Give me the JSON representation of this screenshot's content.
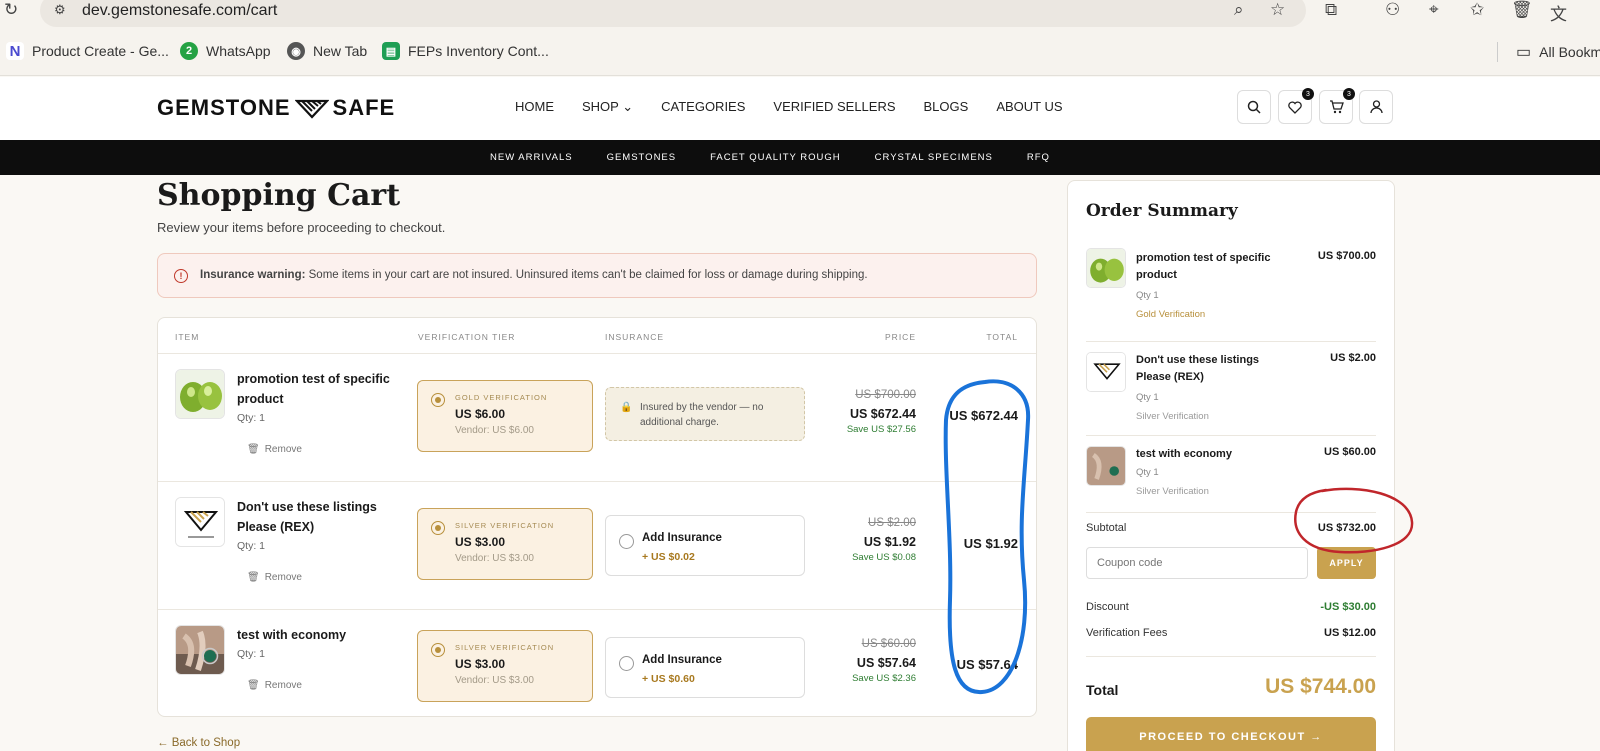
{
  "browser": {
    "url": "dev.gemstonesafe.com/cart",
    "bookmarks": [
      {
        "label": "Product Create - Ge...",
        "icon": "notion-icon"
      },
      {
        "label": "WhatsApp",
        "icon": "whatsapp-icon",
        "badge": "2"
      },
      {
        "label": "New Tab",
        "icon": "chrome-icon"
      },
      {
        "label": "FEPs Inventory Cont...",
        "icon": "sheets-icon"
      }
    ],
    "all_bookmarks": "All Bookm"
  },
  "header": {
    "logo_left": "GEMSTONE",
    "logo_right": "SAFE",
    "nav": [
      {
        "label": "HOME"
      },
      {
        "label": "SHOP ⌄"
      },
      {
        "label": "CATEGORIES"
      },
      {
        "label": "VERIFIED SELLERS"
      },
      {
        "label": "BLOGS"
      },
      {
        "label": "ABOUT US"
      }
    ],
    "wishlist_count": "3",
    "cart_count": "3",
    "subnav": [
      {
        "label": "NEW ARRIVALS"
      },
      {
        "label": "GEMSTONES"
      },
      {
        "label": "FACET QUALITY ROUGH"
      },
      {
        "label": "CRYSTAL SPECIMENS"
      },
      {
        "label": "RFQ"
      }
    ]
  },
  "cart": {
    "title": "Shopping Cart",
    "subtitle": "Review your items before proceeding to checkout.",
    "warning_bold": "Insurance warning:",
    "warning_text": "Some items in your cart are not insured. Uninsured items can't be claimed for loss or damage during shipping.",
    "columns": {
      "item": "ITEM",
      "tier": "VERIFICATION TIER",
      "insurance": "INSURANCE",
      "price": "PRICE",
      "total": "TOTAL"
    },
    "items": [
      {
        "name": "promotion test of specific product",
        "qty": "Qty: 1",
        "remove": "Remove",
        "tier_label": "GOLD VERIFICATION",
        "tier_price": "US $6.00",
        "tier_vendor": "Vendor: US $6.00",
        "insurance_note": "Insured by the vendor — no additional charge.",
        "price_old": "US $700.00",
        "price_now": "US $672.44",
        "price_save": "Save US $27.56",
        "total": "US $672.44"
      },
      {
        "name": "Don't use these listings Please (REX)",
        "qty": "Qty: 1",
        "remove": "Remove",
        "tier_label": "SILVER VERIFICATION",
        "tier_price": "US $3.00",
        "tier_vendor": "Vendor: US $3.00",
        "insurance_label": "Add Insurance",
        "insurance_price": "+ US $0.02",
        "price_old": "US $2.00",
        "price_now": "US $1.92",
        "price_save": "Save US $0.08",
        "total": "US $1.92"
      },
      {
        "name": "test with economy",
        "qty": "Qty: 1",
        "remove": "Remove",
        "tier_label": "SILVER VERIFICATION",
        "tier_price": "US $3.00",
        "tier_vendor": "Vendor: US $3.00",
        "insurance_label": "Add Insurance",
        "insurance_price": "+ US $0.60",
        "price_old": "US $60.00",
        "price_now": "US $57.64",
        "price_save": "Save US $2.36",
        "total": "US $57.64"
      }
    ],
    "back_link": "← Back to Shop"
  },
  "summary": {
    "title": "Order Summary",
    "items": [
      {
        "name": "promotion test of specific product",
        "price": "US $700.00",
        "qty": "Qty 1",
        "tier": "Gold Verification",
        "tier_color": "#b8903c"
      },
      {
        "name": "Don't use these listings Please (REX)",
        "price": "US $2.00",
        "qty": "Qty 1",
        "tier": "Silver Verification",
        "tier_color": "#9a9a9a"
      },
      {
        "name": "test with economy",
        "price": "US $60.00",
        "qty": "Qty 1",
        "tier": "Silver Verification",
        "tier_color": "#9a9a9a"
      }
    ],
    "subtotal_label": "Subtotal",
    "subtotal": "US $732.00",
    "coupon_placeholder": "Coupon code",
    "apply": "APPLY",
    "discount_label": "Discount",
    "discount": "-US $30.00",
    "fees_label": "Verification Fees",
    "fees": "US $12.00",
    "total_label": "Total",
    "total": "US $744.00",
    "checkout": "PROCEED TO CHECKOUT →"
  },
  "colors": {
    "accent_gold": "#c9a24f",
    "save_green": "#2e7d32",
    "annotation_blue": "#1a73d9",
    "annotation_red": "#c0262b"
  }
}
